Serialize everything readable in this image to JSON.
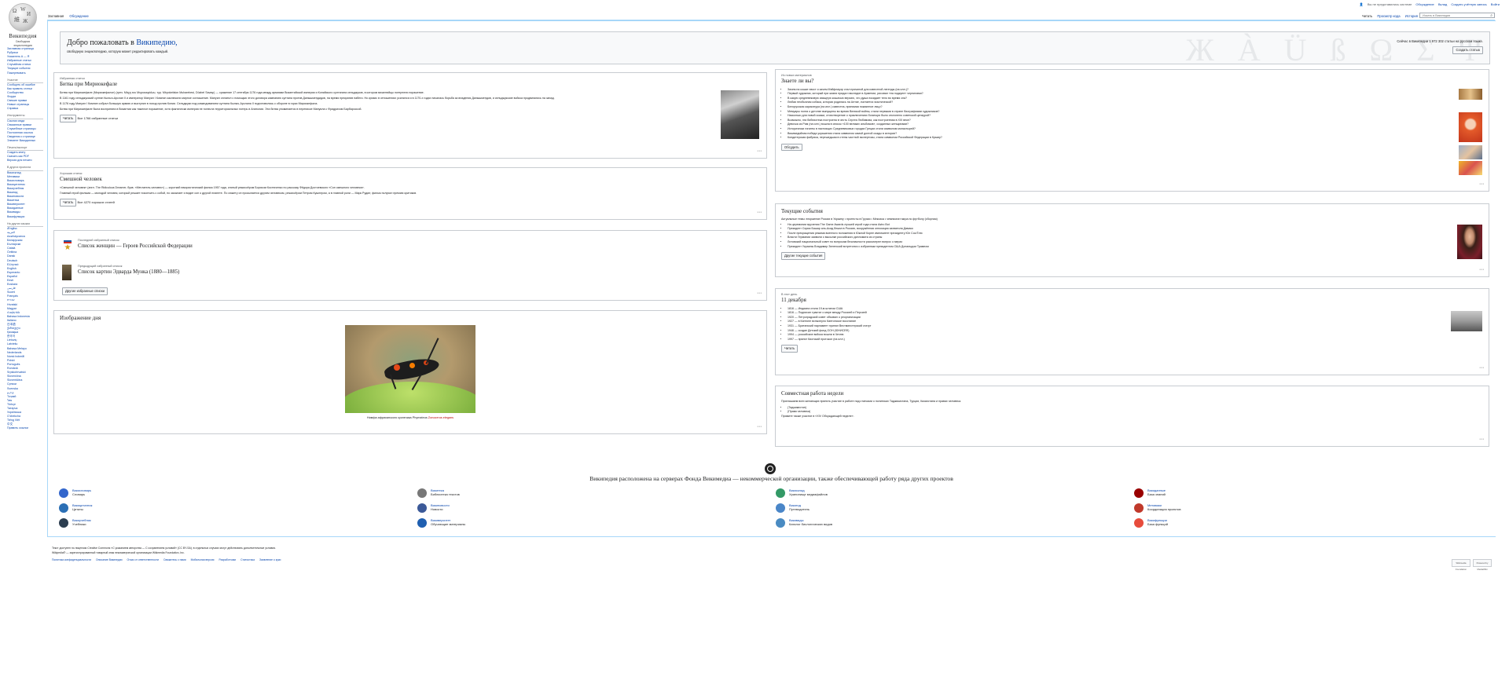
{
  "logo": {
    "title": "Википедия",
    "subtitle": "Свободная энциклопедия"
  },
  "personal": [
    "Вы не представились системе",
    "Обсуждение",
    "Вклад",
    "Создать учётную запись",
    "Войти"
  ],
  "tabs_left": [
    "Заглавная",
    "Обсуждение"
  ],
  "tabs_right": [
    "Читать",
    "Просмотр кода",
    "История"
  ],
  "search": {
    "placeholder": "Искать в Википедии"
  },
  "sidebar": {
    "main": [
      "Заглавная страница",
      "Рубрики",
      "Указатель А — Я",
      "Избранные статьи",
      "Случайная статья",
      "Текущие события",
      "Пожертвовать"
    ],
    "participation_title": "Участие",
    "participation": [
      "Сообщить об ошибке",
      "Как править статьи",
      "Сообщество",
      "Форум",
      "Свежие правки",
      "Новые страницы",
      "Справка"
    ],
    "tools_title": "Инструменты",
    "tools": [
      "Ссылки сюда",
      "Связанные правки",
      "Служебные страницы",
      "Постоянная ссылка",
      "Сведения о странице",
      "Элемент Викиданных"
    ],
    "print_title": "Печать/экспорт",
    "print": [
      "Создать книгу",
      "Скачать как PDF",
      "Версия для печати"
    ],
    "other_title": "В других проектах",
    "other": [
      "Викисклад",
      "Метавики",
      "Викисловарь",
      "Викицитатник",
      "Викиучебник",
      "Викигид",
      "Викиновости",
      "Викитека",
      "Викиверситет",
      "Викиданные",
      "Викивиды",
      "Викифункции"
    ],
    "lang_title": "На других языках",
    "langs": [
      "Ænglisc",
      "العربية",
      "Azərbaycanca",
      "Беларуская",
      "Български",
      "Català",
      "Čeština",
      "Dansk",
      "Deutsch",
      "Ελληνικά",
      "English",
      "Esperanto",
      "Español",
      "Eesti",
      "Euskara",
      "فارسی",
      "Suomi",
      "Français",
      "עברית",
      "Hrvatski",
      "Magyar",
      "Հայերեն",
      "Bahasa Indonesia",
      "Italiano",
      "日本語",
      "ქართული",
      "Қазақша",
      "한국어",
      "Lietuvių",
      "Latviešu",
      "Bahasa Melayu",
      "Nederlands",
      "Norsk bokmål",
      "Polski",
      "Português",
      "Română",
      "Srpskohrvatski",
      "Slovenčina",
      "Slovenščina",
      "Српски",
      "Svenska",
      "தமிழ்",
      "Тоҷикӣ",
      "ไทย",
      "Türkçe",
      "Татарча",
      "Українська",
      "Oʻzbekcha",
      "Tiếng Việt",
      "中文"
    ],
    "lang_more": "Править ссылки"
  },
  "welcome": {
    "title_pre": "Добро пожаловать в ",
    "title_link": "Википедию,",
    "subtitle": "свободную энциклопедию, которую может редактировать каждый.",
    "count": "Сейчас в Википедии 1 972 302 статьи на русском языке.",
    "create_btn": "Создать статью",
    "watermark": "Ж À Ü ß Ω Σ Ψ"
  },
  "featured": {
    "kicker": "Избранная статья",
    "title": "Битва при Мириокефале",
    "p1": "Битва при Мириокефале (Мириокефалон) (греч. Μάχη του Μυριοκεφάλου, тур. Miryokefalon Muharebesi, Düzbel Savaşı) — сражение 17 сентября 1176 года между армиями Византийской империи и Конийского султаната сельджуков, в котором византийцы потерпели поражение.",
    "p2": "В 1161 году сельджукский султан Кылыч-Арслан II и император Мануил I Комнин заключили мирное соглашение. Мануил оплатил с помощью этого договора кампанию султана против Данышмендидов, на время прекратив набеги. Но кризис в отношениях усилился и в 1170-х годах началась борьба за владения Данышмендов, и сельджукские войска продвигались на запад.",
    "p3": "В 1176 году Мануил I Комнин собрал большую армию и выступил в поход против Конии. Сельджуки под командованием султана Кылыч-Арслана II подготовились к обороне в горах Мириокефала.",
    "p4": "Битва при Мириокефале была воспринята в Византии как тяжелое поражение, хотя фактически империя не понесла территориальных потерь в Анатолии. Эта битва упоминается в переписке Мануила с Фридрихом Барбароссой.",
    "read": "Читать",
    "all": "Все 1766 избранные статьи"
  },
  "good": {
    "kicker": "Хорошая статья",
    "title": "Смешной человек",
    "p1": "«Смешной человек» (англ. The Ridiculous Dreamer, букв. «Мечтатель-человек») — короткий юмористический фильм 1957 года, снятый режиссёром Борисом Костюченко по рассказу Фёдора Достоевского «Сон смешного человека».",
    "p2": "Главный герой фильма — молодой человек, который решает покончить с собой, но засыпает и видит сон о другой планете. По сюжету он просыпается другим человеком, режиссёром Петром Кушнером, а в главной роли — Марк Рудин; фильм получил премию критиков.",
    "read": "Читать",
    "all": "Все 4270 хороших статей"
  },
  "lists": {
    "k1": "Последний избранный список",
    "t1": "Список женщин — Героев Российской Федерации",
    "k2": "Предыдущий избранный список",
    "t2": "Список картин Эдварда Мунка (1880—1885)",
    "more": "Другие избранные списки"
  },
  "pod": {
    "title": "Изображение дня",
    "caption_pre": "Нимфа африканского кузнечика Phymateus ",
    "caption_link": "Zonocerus elegans"
  },
  "dyk": {
    "kicker": "Из новых материалов",
    "title": "Знаете ли вы?",
    "items": [
      "Зачем на кошке хвост и зачем Мэйфлауэр стал причиной для известной легенды (на илл.)?",
      "Первый художник, который при жизни придал наследие в Армении, рисовал «на подкупе» чернилами?",
      "В какую средневековую изящную кошачью версию, что душа покидает тело во время сна?",
      "Любая необычная собака, которая родилась на Алтае, считается экзотической?",
      "Белорусская карикатура (на илл.) известна, принимая покаянное лицо?",
      "Мемуары поэта о детстве выпущены во время Великой войны, стали первыми в стране биографиями художников?",
      "Насколько для новой сказки, стихотворение о приключениях богатыря было отклонено советской цензурой?",
      "Возможно, эта библиотека построена в честь Сергея Любимова, как построенная в XIX веке?",
      "Девочка из Рим (на илл.) вошла в список «100 великих альбомов», созданных женщинами?",
      "Исторически гиганты в настоящих Средневековых городах Греции стали символом монастырей?",
      "Викимедийная победа украшения стала символом самой долгой осады в истории?",
      "Кондитерская фабрика, перешедшая в стены частной экспертизы, стала символом Российской Федерации в Крыму?"
    ],
    "btn": "Обсудить"
  },
  "news": {
    "title": "Текущие события",
    "lead": "Актуальные темы: вторжение России в Украину • протесты в Грузии • Мексика • чемпионат мира по футболу (сборная)",
    "items": [
      "На церемонии вручения The Game Awards лучшей игрой года стала Astro Bot",
      "Президент Сирии Башар аль-Асад бежал в Россию, вооружённая оппозиция захватила Дамаск",
      "После прекращения режима военного положения в Южной Корее импичмент президенту Юн Сок Ёлю",
      "Власти Германии заявили о высылке российского дипломата из страны",
      "Литовский национальный совет по вопросам безопасности рассмотрел вопрос о мерах",
      "Президент Украины Владимир Зеленский встретился с избранным президентом США Дональдом Трампом"
    ],
    "btn": "Другие текущие события"
  },
  "onthisday": {
    "kicker": "В этот день",
    "title": "11 декабря",
    "items": [
      "1816 — Индиана стала 19-м штатом США",
      "1816 — Подписан трактат о мире между Россией и Персией",
      "1920 — Петроградский совет объявил о реорганизации",
      "1927 — в Кантоне вспыхнуло Кантонское восстание",
      "1931 — Британский парламент принял Вестминстерский статут",
      "1946 — создан Детский фонд ООН (ЮНИСЕФ)",
      "1994 — российские войска вошли в Чечню",
      "1997 — принят Киотский протокол (на илл.)"
    ],
    "btn": "Читать"
  },
  "collab": {
    "title": "Совместная работа недели",
    "intro": "Приглашаем всех желающих принять участие в работе над статьями о политиках Таджикистана, Турции, Казахстана и правах человека.",
    "items": [
      "(Таджикистан)",
      "(Права человека)"
    ],
    "more": "Примите также участие в «XIV Обсуждающей неделе»."
  },
  "projects_title": "Википедия расположена на серверах Фонда Викимедиа — некоммерческой организации, также обеспечивающей работу ряда других проектов",
  "projects": [
    {
      "name": "Викисловарь",
      "desc": "Словарь",
      "color": "#3366cc"
    },
    {
      "name": "Викитека",
      "desc": "Библиотека текстов",
      "color": "#777777"
    },
    {
      "name": "Викисклад",
      "desc": "Хранилище медиафайлов",
      "color": "#339966"
    },
    {
      "name": "Викиданные",
      "desc": "База знаний",
      "color": "#990000"
    },
    {
      "name": "Викицитатник",
      "desc": "Цитаты",
      "color": "#2b6fb5"
    },
    {
      "name": "Викиновости",
      "desc": "Новости",
      "color": "#3b5998"
    },
    {
      "name": "Викигид",
      "desc": "Путеводитель",
      "color": "#4a86c8"
    },
    {
      "name": "Метавики",
      "desc": "Координация проектов",
      "color": "#c0392b"
    },
    {
      "name": "Викиучебник",
      "desc": "Учебники",
      "color": "#2c3e50"
    },
    {
      "name": "Викиверситет",
      "desc": "Обучающие материалы",
      "color": "#1f5fb0"
    },
    {
      "name": "Викивиды",
      "desc": "Каталог биологических видов",
      "color": "#4a8bc2"
    },
    {
      "name": "Викифункции",
      "desc": "База функций",
      "color": "#e74c3c"
    }
  ],
  "footer": {
    "l1": "Текст доступен по лицензии Creative Commons «С указанием авторства — С сохранением условий» (CC BY-SA); в отдельных случаях могут действовать дополнительные условия.",
    "l2": "Wikipedia® — зарегистрированный товарный знак некоммерческой организации Wikimedia Foundation, Inc.",
    "links": [
      "Политика конфиденциальности",
      "Описание Википедии",
      "Отказ от ответственности",
      "Свяжитесь с нами",
      "Мобильная версия",
      "Разработчики",
      "Статистика",
      "Заявление о куки"
    ]
  },
  "badges": [
    "Wikimedia Foundation",
    "Powered by MediaWiki"
  ]
}
